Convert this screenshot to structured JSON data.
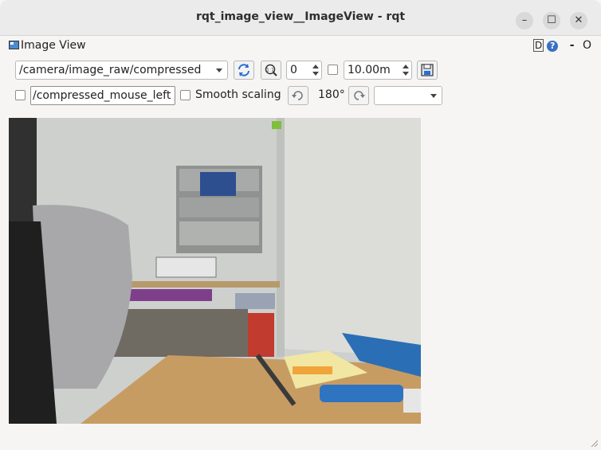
{
  "window": {
    "title": "rqt_image_view__ImageView - rqt",
    "minimize_glyph": "–",
    "maximize_glyph": "☐",
    "close_glyph": "✕"
  },
  "dock": {
    "title": "Image View",
    "icon": "image-view-icon",
    "d_label": "D",
    "help_label": "?",
    "minus_label": "-",
    "o_label": "O"
  },
  "toolbar": {
    "topic_selected": "/camera/image_raw/compressed",
    "refresh_icon": "refresh-icon",
    "zoom_icon": "zoom-fit-icon",
    "spin_value": "0",
    "max_range_value": "10.00m",
    "save_icon": "save-icon",
    "mouse_topic_value": "/compressed_mouse_left",
    "smooth_scaling_label": "Smooth scaling",
    "rotate_left_icon": "rotate-left-icon",
    "rotation_label": "180°",
    "rotate_right_icon": "rotate-right-icon",
    "color_scheme_selected": ""
  },
  "colors": {
    "accent": "#3a6fc4",
    "window_bg": "#f6f5f4",
    "titlebar_bg": "#ebebeb"
  }
}
